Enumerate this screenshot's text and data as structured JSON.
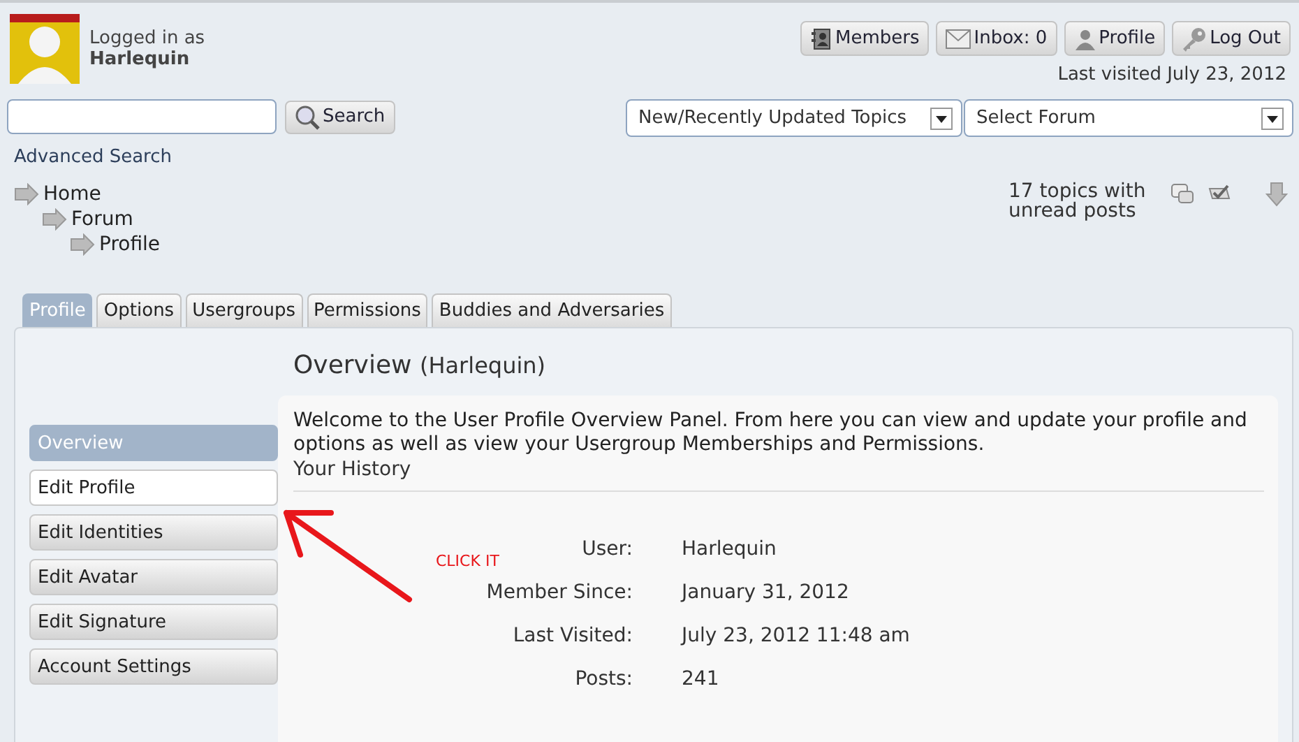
{
  "user": {
    "logged_in_label": "Logged in as",
    "name": "Harlequin"
  },
  "top_buttons": [
    {
      "kind": "members",
      "label": "Members"
    },
    {
      "kind": "inbox",
      "label": "Inbox: 0"
    },
    {
      "kind": "profile",
      "label": "Profile"
    },
    {
      "kind": "logout",
      "label": "Log Out"
    }
  ],
  "last_visited": "Last visited July 23, 2012",
  "search": {
    "button": "Search",
    "advanced_link": "Advanced Search"
  },
  "dropdowns": [
    {
      "value": "New/Recently Updated Topics"
    },
    {
      "value": "Select Forum"
    }
  ],
  "breadcrumbs": [
    {
      "label": "Home",
      "children": [
        {
          "label": "Forum",
          "children": [
            {
              "label": "Profile"
            }
          ]
        }
      ]
    }
  ],
  "unread": "17 topics with unread posts",
  "tabs": [
    {
      "label": "Profile",
      "selected": true
    },
    {
      "label": "Options",
      "selected": false
    },
    {
      "label": "Usergroups",
      "selected": false
    },
    {
      "label": "Permissions",
      "selected": false
    },
    {
      "label": "Buddies and Adversaries",
      "selected": false
    }
  ],
  "sidebar": {
    "items": [
      {
        "label": "Overview",
        "selected": true,
        "hovered": false
      },
      {
        "label": "Edit Profile",
        "selected": false,
        "hovered": true
      },
      {
        "label": "Edit Identities",
        "selected": false,
        "hovered": false
      },
      {
        "label": "Edit Avatar",
        "selected": false,
        "hovered": false
      },
      {
        "label": "Edit Signature",
        "selected": false,
        "hovered": false
      },
      {
        "label": "Account Settings",
        "selected": false,
        "hovered": false
      }
    ]
  },
  "overview": {
    "title": "Overview",
    "subtitle": "(Harlequin)",
    "intro": "Welcome to the User Profile Overview Panel. From here you can view and update your profile and options as well as view your Usergroup Memberships and Permissions.",
    "history_heading": "Your History",
    "fields": [
      {
        "label": "User:",
        "value": "Harlequin"
      },
      {
        "label": "Member Since:",
        "value": "January 31, 2012"
      },
      {
        "label": "Last Visited:",
        "value": "July 23, 2012 11:48 am"
      },
      {
        "label": "Posts:",
        "value": "241"
      }
    ]
  },
  "annotation": {
    "text": "CLICK IT"
  }
}
